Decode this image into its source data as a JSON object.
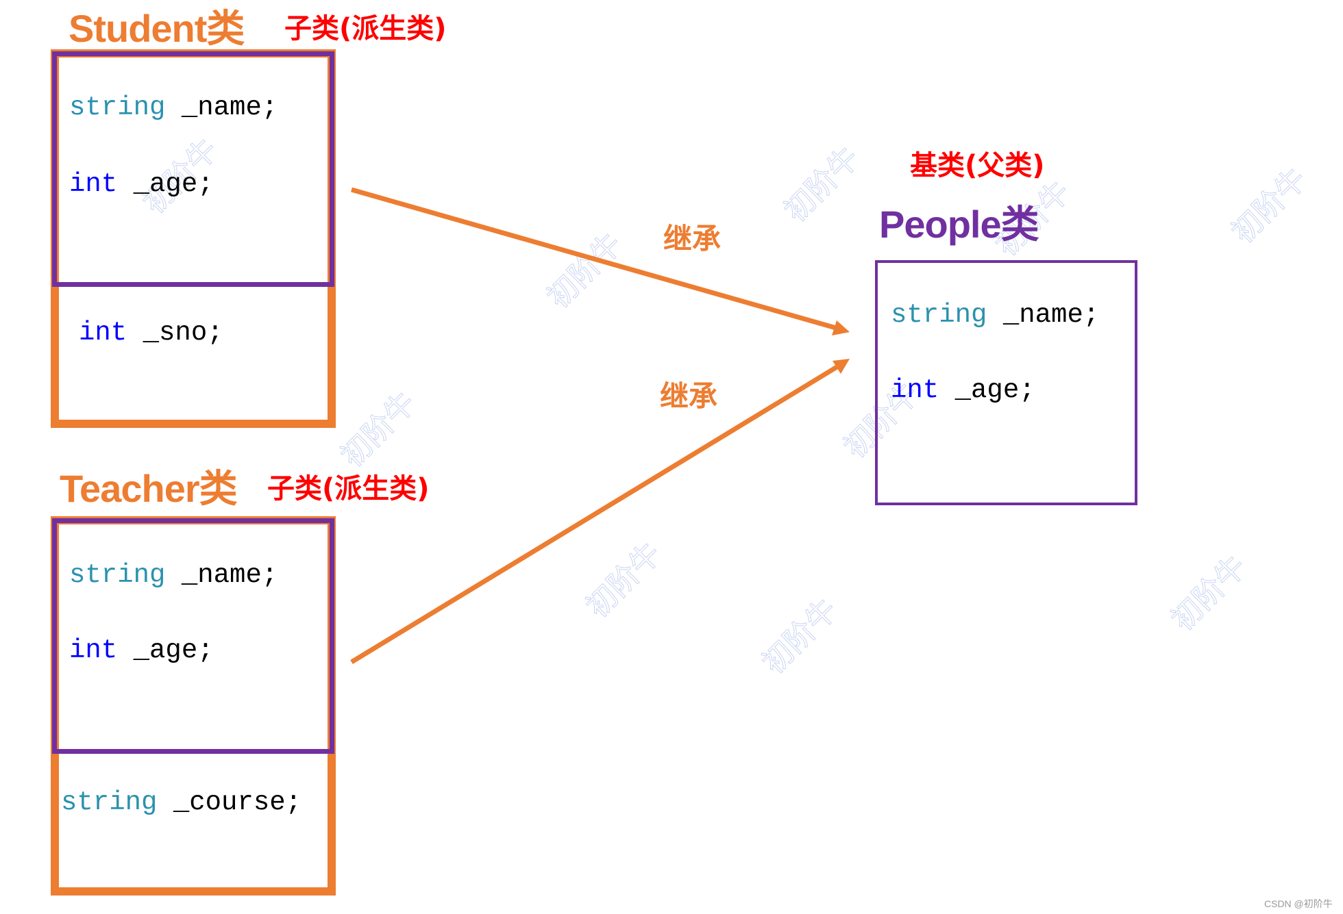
{
  "colors": {
    "derived_title": "#ed7d31",
    "base_title": "#7030a0",
    "role_label": "#ff0000",
    "type_keyword": "#2b91af",
    "int_keyword": "#0000ff",
    "arrow": "#ed7d31",
    "watermark": "#c9d5f2"
  },
  "student": {
    "title": "Student类",
    "role": "子类(派生类)",
    "inherited_members": [
      {
        "type": "string",
        "name": " _name;"
      },
      {
        "type": "int",
        "name": " _age;"
      }
    ],
    "own_members": [
      {
        "type": "int",
        "name": " _sno;"
      }
    ]
  },
  "teacher": {
    "title": "Teacher类",
    "role": "子类(派生类)",
    "inherited_members": [
      {
        "type": "string",
        "name": " _name;"
      },
      {
        "type": "int",
        "name": " _age;"
      }
    ],
    "own_members": [
      {
        "type": "string",
        "name": " _course;"
      }
    ]
  },
  "people": {
    "role": "基类(父类)",
    "title": "People类",
    "members": [
      {
        "type": "string",
        "name": " _name;"
      },
      {
        "type": "int",
        "name": " _age;"
      }
    ]
  },
  "edges": [
    {
      "from": "student",
      "to": "people",
      "label": "继承"
    },
    {
      "from": "teacher",
      "to": "people",
      "label": "继承"
    }
  ],
  "watermark": {
    "text": "初阶牛",
    "credit": "CSDN @初阶牛"
  }
}
